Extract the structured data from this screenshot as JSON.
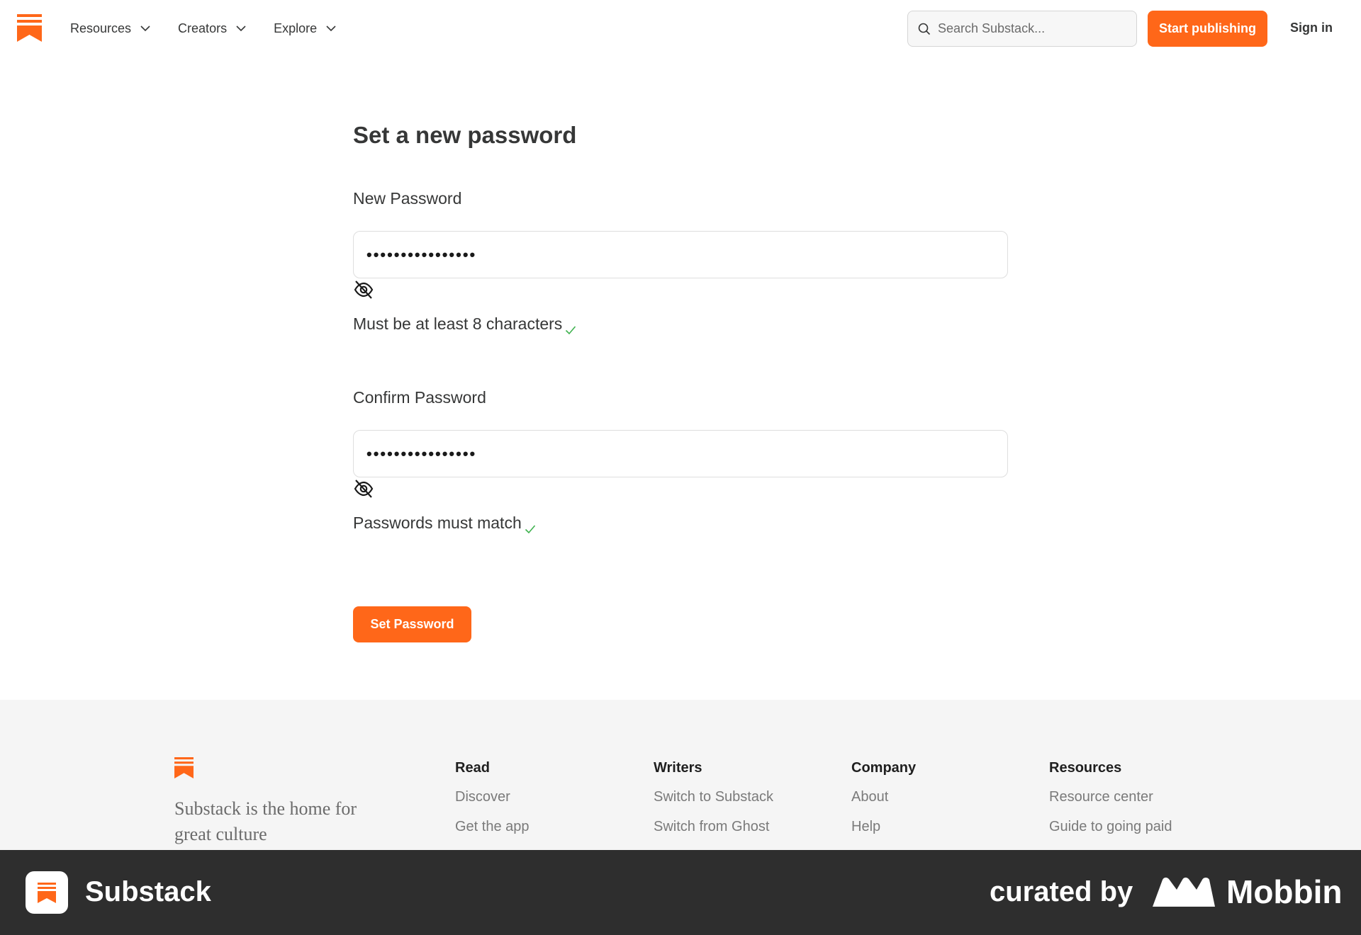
{
  "header": {
    "nav": [
      {
        "label": "Resources"
      },
      {
        "label": "Creators"
      },
      {
        "label": "Explore"
      }
    ],
    "search_placeholder": "Search Substack...",
    "start_label": "Start publishing",
    "signin_label": "Sign in"
  },
  "form": {
    "title": "Set a new password",
    "new_password": {
      "label": "New Password",
      "value": "••••••••••••••••",
      "hint": "Must be at least 8 characters"
    },
    "confirm_password": {
      "label": "Confirm Password",
      "value": "••••••••••••••••",
      "hint": "Passwords must match"
    },
    "submit_label": "Set Password"
  },
  "footer": {
    "tagline": "Substack is the home for great culture",
    "columns": [
      {
        "heading": "Read",
        "links": [
          "Discover",
          "Get the app"
        ]
      },
      {
        "heading": "Writers",
        "links": [
          "Switch to Substack",
          "Switch from Ghost"
        ]
      },
      {
        "heading": "Company",
        "links": [
          "About",
          "Help"
        ]
      },
      {
        "heading": "Resources",
        "links": [
          "Resource center",
          "Guide to going paid"
        ]
      }
    ]
  },
  "banner": {
    "app_name": "Substack",
    "curated_label": "curated by",
    "brand": "Mobbin"
  },
  "colors": {
    "accent": "#ff6719",
    "check": "#3fb24f",
    "banner_bg": "#2e2e2e",
    "footer_bg": "#f5f5f5"
  }
}
